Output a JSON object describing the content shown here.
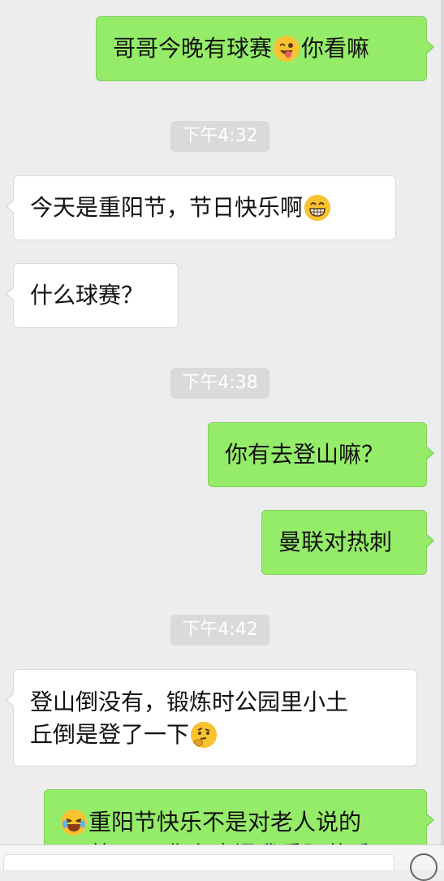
{
  "messages": [
    {
      "side": "out",
      "text_before": "哥哥今晚有球赛",
      "emoji": "winking-tongue-emoji",
      "text_after": "你看嘛"
    },
    {
      "type": "time",
      "text": "下午4:32"
    },
    {
      "side": "in",
      "text_before": "今天是重阳节，节日快乐啊",
      "emoji": "grinning-face-emoji"
    },
    {
      "side": "in",
      "text": "什么球赛？"
    },
    {
      "type": "time",
      "text": "下午4:38"
    },
    {
      "side": "out",
      "text": "你有去登山嘛？"
    },
    {
      "side": "out",
      "text": "曼联对热刺"
    },
    {
      "type": "time",
      "text": "下午4:42"
    },
    {
      "side": "in",
      "line1": "登山倒没有，锻炼时公园里小土",
      "line2": "丘倒是登了一下",
      "emoji": "thinking-face-emoji"
    },
    {
      "side": "out",
      "emoji": "laughing-crying-emoji",
      "line1": "重阳节快乐不是对老人说的",
      "line2": "吗 等一下 你在内涵我重阳节丢"
    }
  ],
  "colors": {
    "background": "#ededed",
    "incoming_bubble": "#ffffff",
    "outgoing_bubble": "#95ec69",
    "timestamp_bg": "#dadada"
  }
}
